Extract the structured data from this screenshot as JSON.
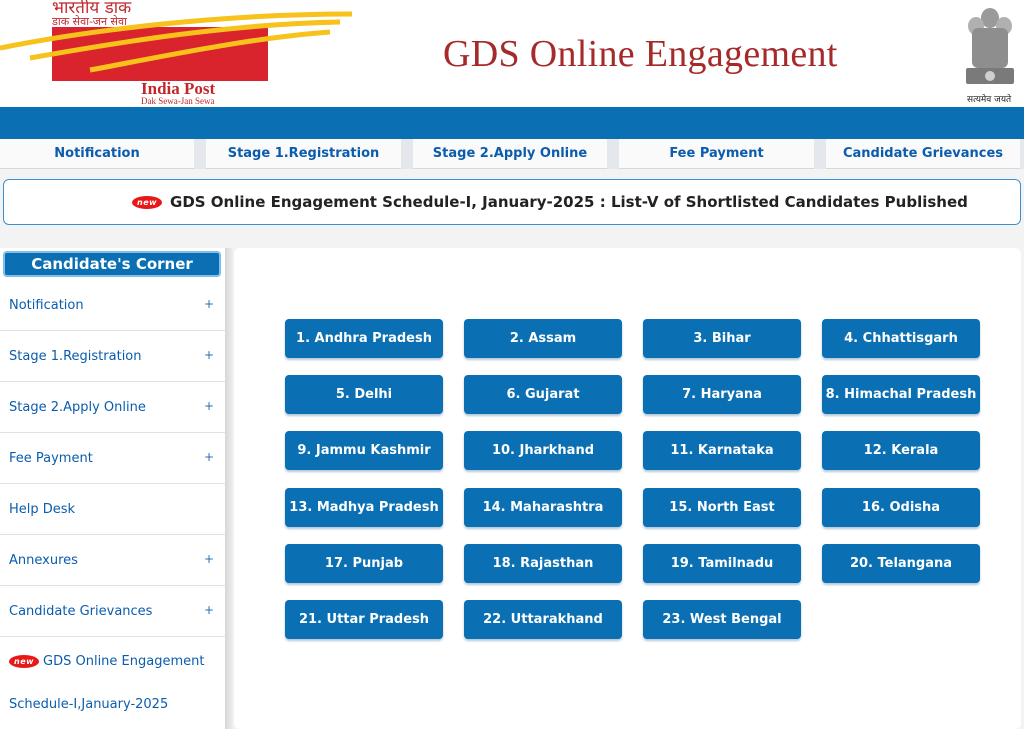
{
  "header": {
    "logo_hindi": "भारतीय डाक",
    "logo_hindi_sub": "डाक सेवा-जन सेवा",
    "logo_name": "India Post",
    "logo_tagline": "Dak Sewa-Jan Sewa",
    "title": "GDS Online Engagement",
    "emblem_caption": "सत्यमेव जयते"
  },
  "nav": {
    "tabs": [
      "Notification",
      "Stage 1.Registration",
      "Stage 2.Apply Online",
      "Fee Payment",
      "Candidate Grievances"
    ]
  },
  "marquee": {
    "badge": "new",
    "text": "GDS Online Engagement Schedule-I, January-2025 : List-V of Shortlisted Candidates Published"
  },
  "sidebar": {
    "title": "Candidate's Corner",
    "items": [
      {
        "label": "Notification",
        "plus": "+"
      },
      {
        "label": "Stage 1.Registration",
        "plus": "+"
      },
      {
        "label": "Stage 2.Apply Online",
        "plus": "+"
      },
      {
        "label": "Fee Payment",
        "plus": "+"
      },
      {
        "label": "Help Desk",
        "plus": ""
      },
      {
        "label": "Annexures",
        "plus": "+"
      },
      {
        "label": "Candidate Grievances",
        "plus": "+"
      }
    ],
    "new_badge": "new",
    "new_line1": "GDS Online Engagement",
    "new_line2": "Schedule-I,January-2025"
  },
  "states": [
    "1. Andhra Pradesh",
    "2. Assam",
    "3. Bihar",
    "4. Chhattisgarh",
    "5. Delhi",
    "6. Gujarat",
    "7. Haryana",
    "8. Himachal Pradesh",
    "9. Jammu Kashmir",
    "10. Jharkhand",
    "11. Karnataka",
    "12. Kerala",
    "13. Madhya Pradesh",
    "14. Maharashtra",
    "15. North East",
    "16. Odisha",
    "17. Punjab",
    "18. Rajasthan",
    "19. Tamilnadu",
    "20. Telangana",
    "21. Uttar Pradesh",
    "22. Uttarakhand",
    "23. West Bengal"
  ],
  "colors": {
    "primary_blue": "#0a6fb3",
    "title_red": "#a52a2a",
    "logo_red": "#d9232d",
    "logo_yellow": "#f7c21b"
  }
}
